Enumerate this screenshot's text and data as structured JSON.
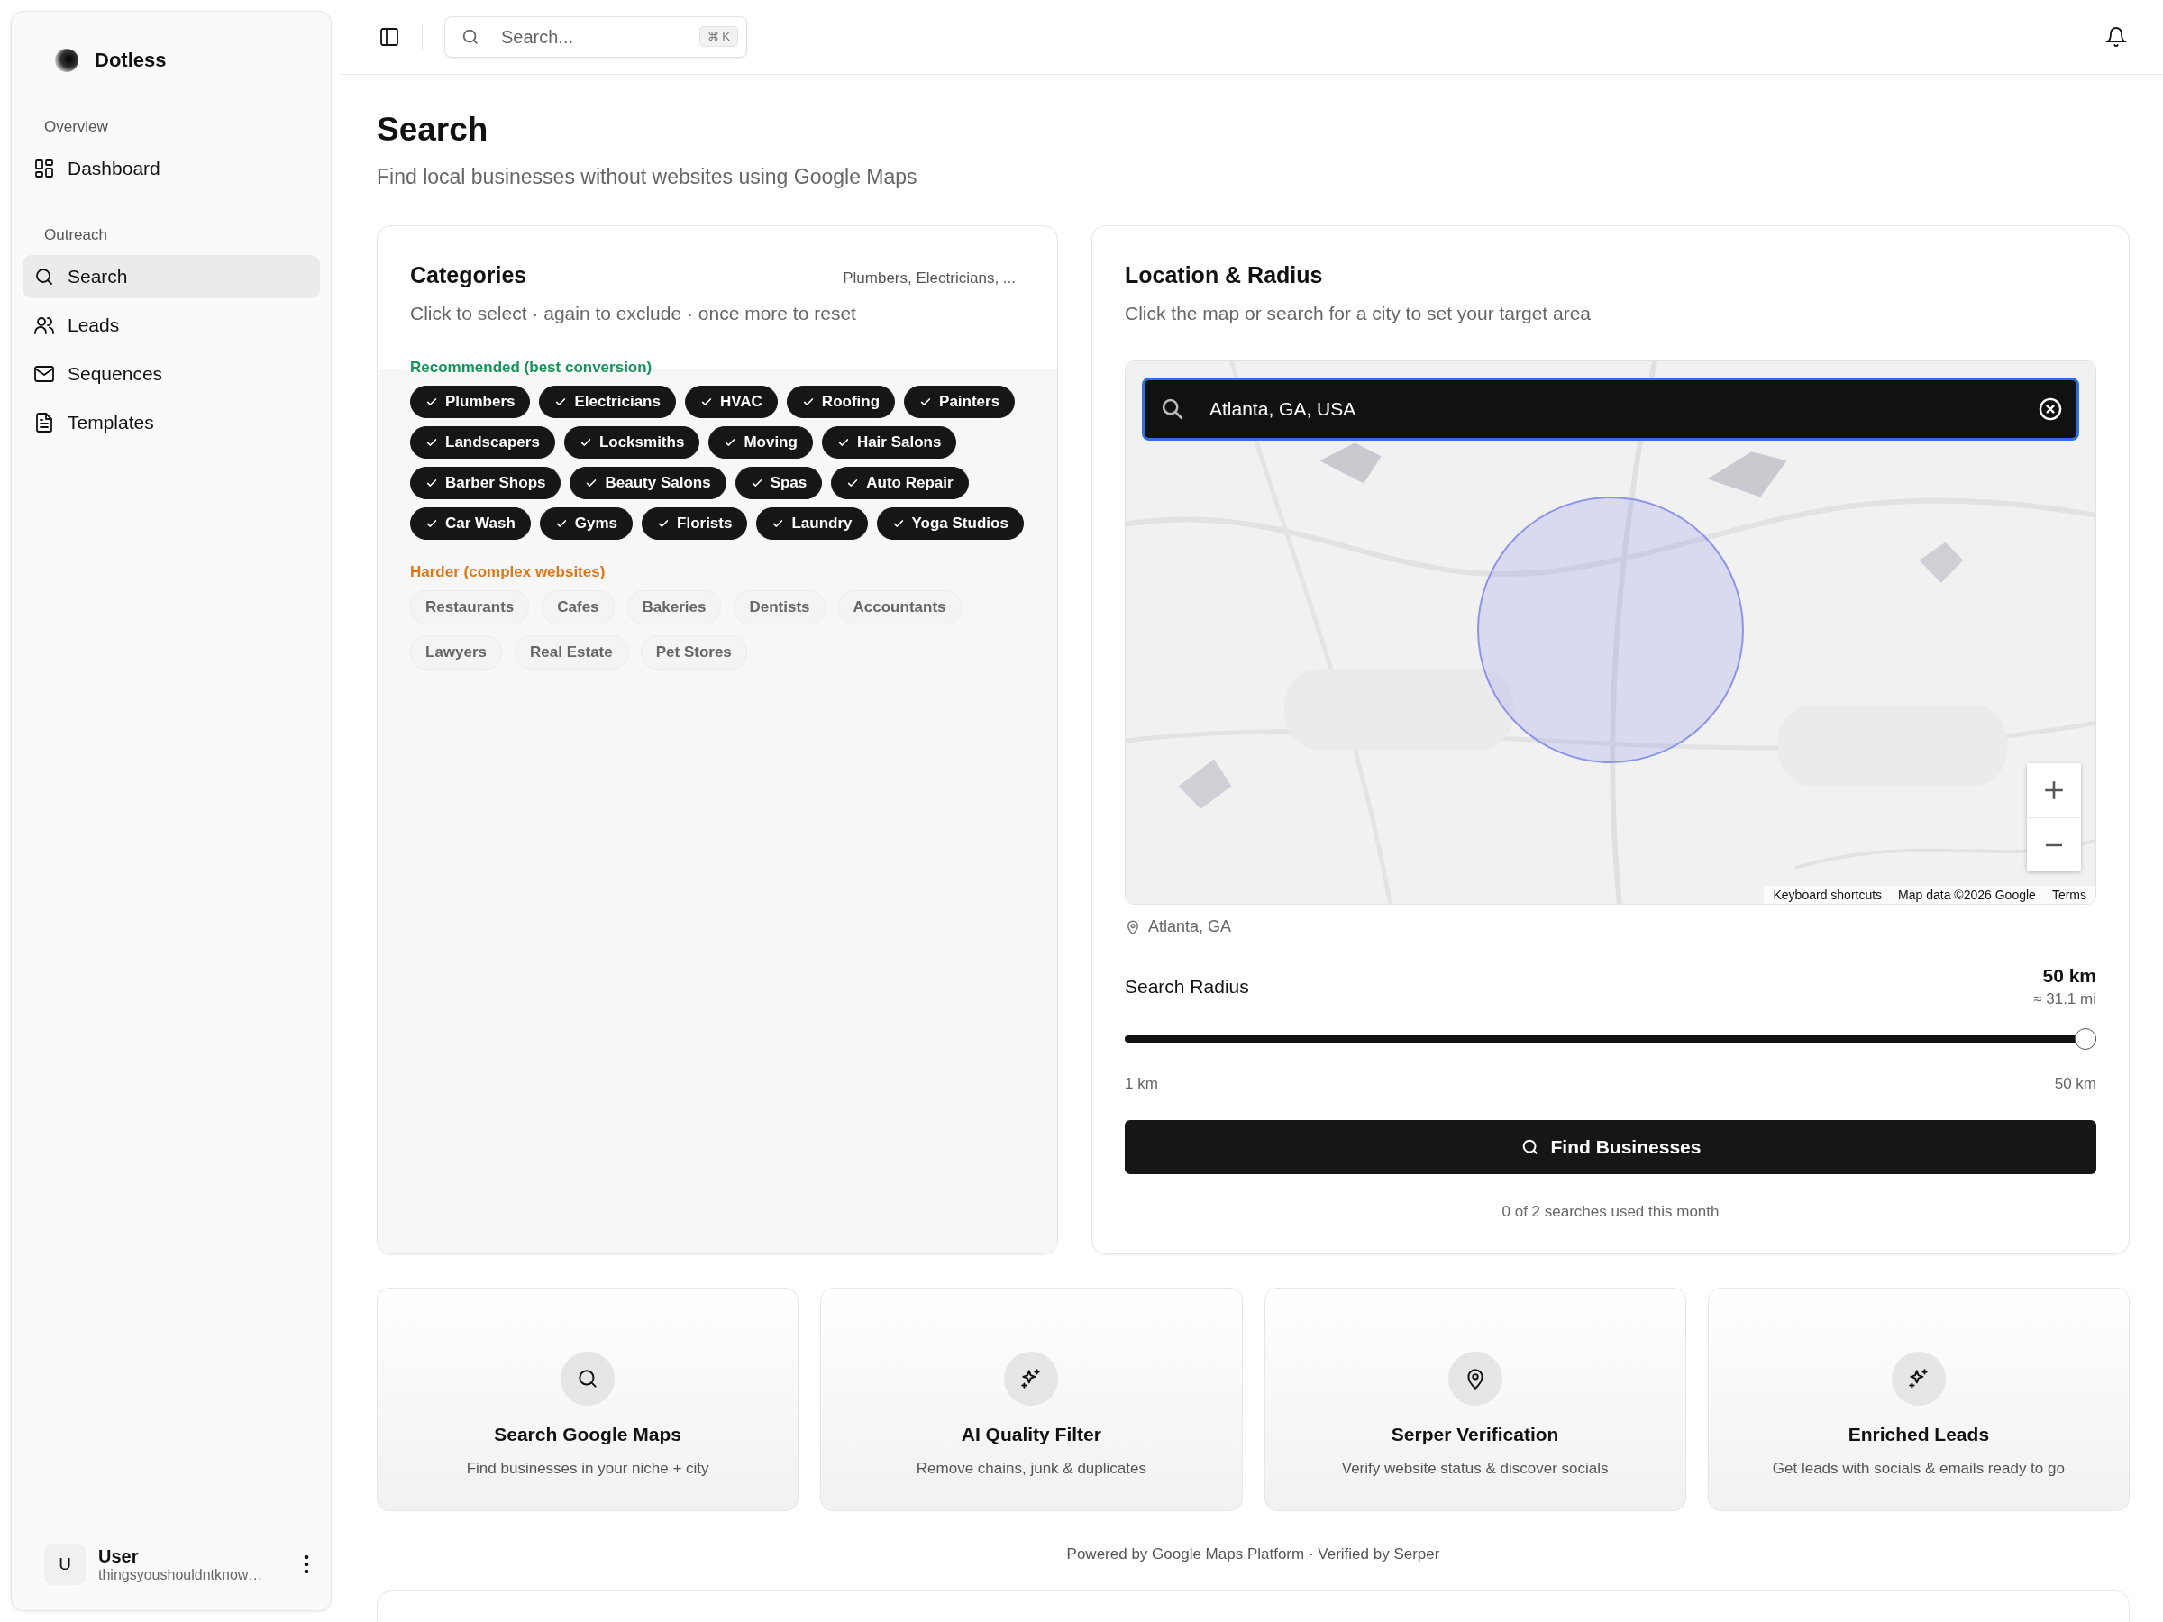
{
  "sidebar": {
    "brand": "Dotless",
    "sections": [
      {
        "title": "Overview",
        "items": [
          {
            "label": "Dashboard",
            "selected": false
          }
        ]
      },
      {
        "title": "Outreach",
        "items": [
          {
            "label": "Search",
            "selected": true
          },
          {
            "label": "Leads",
            "selected": false
          },
          {
            "label": "Sequences",
            "selected": false
          },
          {
            "label": "Templates",
            "selected": false
          }
        ]
      }
    ],
    "user": {
      "avatar": "U",
      "name": "User",
      "email": "thingsyoushouldntknow…"
    }
  },
  "topbar": {
    "search": {
      "placeholder": "Search...",
      "shortcut": "⌘ K"
    }
  },
  "page": {
    "title": "Search",
    "subtitle": "Find local businesses without websites using Google Maps"
  },
  "categories": {
    "title": "Categories",
    "summary": "Plumbers, Electricians, ...",
    "hint": "Click to select · again to exclude · once more to reset",
    "groups": [
      {
        "label": "Recommended (best conversion)",
        "kind": "recommended",
        "items": [
          {
            "label": "Plumbers",
            "selected": true
          },
          {
            "label": "Electricians",
            "selected": true
          },
          {
            "label": "HVAC",
            "selected": true
          },
          {
            "label": "Roofing",
            "selected": true
          },
          {
            "label": "Painters",
            "selected": true
          },
          {
            "label": "Landscapers",
            "selected": true
          },
          {
            "label": "Locksmiths",
            "selected": true
          },
          {
            "label": "Moving",
            "selected": true
          },
          {
            "label": "Hair Salons",
            "selected": true
          },
          {
            "label": "Barber Shops",
            "selected": true
          },
          {
            "label": "Beauty Salons",
            "selected": true
          },
          {
            "label": "Spas",
            "selected": true
          },
          {
            "label": "Auto Repair",
            "selected": true
          },
          {
            "label": "Car Wash",
            "selected": true
          },
          {
            "label": "Gyms",
            "selected": true
          },
          {
            "label": "Florists",
            "selected": true
          },
          {
            "label": "Laundry",
            "selected": true
          },
          {
            "label": "Yoga Studios",
            "selected": true
          }
        ]
      },
      {
        "label": "Harder (complex websites)",
        "kind": "harder",
        "items": [
          {
            "label": "Restaurants",
            "selected": false
          },
          {
            "label": "Cafes",
            "selected": false
          },
          {
            "label": "Bakeries",
            "selected": false
          },
          {
            "label": "Dentists",
            "selected": false
          },
          {
            "label": "Accountants",
            "selected": false
          },
          {
            "label": "Lawyers",
            "selected": false
          },
          {
            "label": "Real Estate",
            "selected": false
          },
          {
            "label": "Pet Stores",
            "selected": false
          }
        ]
      }
    ]
  },
  "location": {
    "title": "Location & Radius",
    "hint": "Click the map or search for a city to set your target area",
    "map": {
      "kind": "picture",
      "search_value": "Atlanta, GA, USA",
      "attribution": [
        "Keyboard shortcuts",
        "Map data ©2026 Google",
        "Terms"
      ]
    },
    "place": "Atlanta, GA",
    "radius": {
      "label": "Search Radius",
      "value": "50 km",
      "approx": "≈ 31.1 mi",
      "level": 1,
      "min": "1 km",
      "max": "50 km"
    },
    "button": "Find Businesses",
    "usage": "0 of 2 searches used this month"
  },
  "features": [
    {
      "title": "Search Google Maps",
      "text": "Find businesses in your niche + city"
    },
    {
      "title": "AI Quality Filter",
      "text": "Remove chains, junk & duplicates"
    },
    {
      "title": "Serper Verification",
      "text": "Verify website status & discover socials"
    },
    {
      "title": "Enriched Leads",
      "text": "Get leads with socials & emails ready to go"
    }
  ],
  "footer": "Powered by Google Maps Platform · Verified by Serper"
}
